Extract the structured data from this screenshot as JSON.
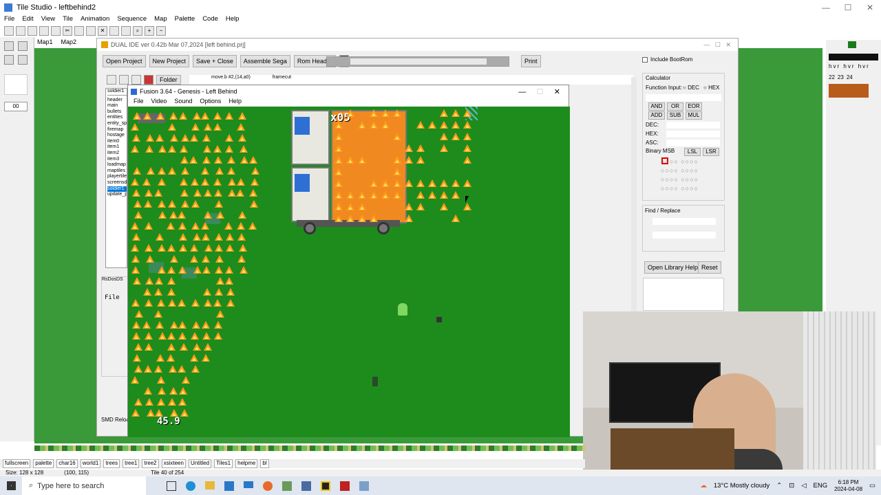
{
  "tile_studio": {
    "title": "Tile Studio - leftbehind2",
    "menu": [
      "File",
      "Edit",
      "View",
      "Tile",
      "Animation",
      "Sequence",
      "Map",
      "Palette",
      "Code",
      "Help"
    ],
    "map_tabs": [
      "Map1",
      "Map2"
    ],
    "left_value": "00",
    "tile_tabs": [
      "fullscreen",
      "palette",
      "char16",
      "world1",
      "trees",
      "tree1",
      "tree2",
      "xsixteen",
      "Untitled",
      "Tiles1",
      "helpme",
      "bl"
    ],
    "status": {
      "size": "Size: 128 x 128",
      "coords": "(100, 115)",
      "tile": "Tile 40 of 254"
    },
    "right_labels": [
      "h",
      "v",
      "r",
      "h",
      "v",
      "r",
      "h",
      "v",
      "r"
    ],
    "right_nums": [
      "22",
      "23",
      "24"
    ]
  },
  "dual_ide": {
    "title": "DUAL IDE ver 0.42b Mar 07,2024  [left behind.prj]",
    "buttons": [
      "Open Project",
      "New Project",
      "Save + Close",
      "Assemble Sega",
      "Rom Header"
    ],
    "print": "Print",
    "folder": "Folder",
    "code_lines": [
      "move.b   #2,(14,a0)",
      "framecut"
    ],
    "files": [
      "soldier1",
      "header",
      "main",
      "bullets",
      "entities",
      "entity_spa",
      "firemap",
      "hostage",
      "item0",
      "item1",
      "item2",
      "item3",
      "loadmap",
      "maptiles",
      "playertiles",
      "screensd",
      "soldier1",
      "update_p"
    ],
    "lower_panel_label": "RsDosDS",
    "lower_file": "File",
    "smd_label": "SMD Reload",
    "include_bootrom": "Include BootRom",
    "calculator": {
      "title": "Calculator",
      "function_input": "Function Input:",
      "dec": "DEC",
      "hex": "HEX",
      "ops_row1": [
        "AND",
        "OR",
        "EOR"
      ],
      "ops_row2": [
        "ADD",
        "SUB",
        "MUL"
      ],
      "fields": [
        "DEC:",
        "HEX:",
        "ASC:"
      ],
      "binary": "Binary MSB",
      "lsl": "LSL",
      "lsr": "LSR"
    },
    "find_replace": "Find / Replace",
    "open_library_help": "Open Library Help",
    "reset": "Reset"
  },
  "fusion": {
    "title": "Fusion 3.64 - Genesis - Left Behind",
    "menu": [
      "File",
      "Video",
      "Sound",
      "Options",
      "Help"
    ],
    "hud_count": "x05",
    "fps": "45.9"
  },
  "taskbar": {
    "search_placeholder": "Type here to search",
    "weather": "13°C  Mostly cloudy",
    "lang": "ENG",
    "time": "6:18 PM",
    "date": "2024-04-08"
  },
  "colors": {
    "grass": "#1d8c1d",
    "fire": "#ff9a1a",
    "accent": "#0078d7"
  }
}
